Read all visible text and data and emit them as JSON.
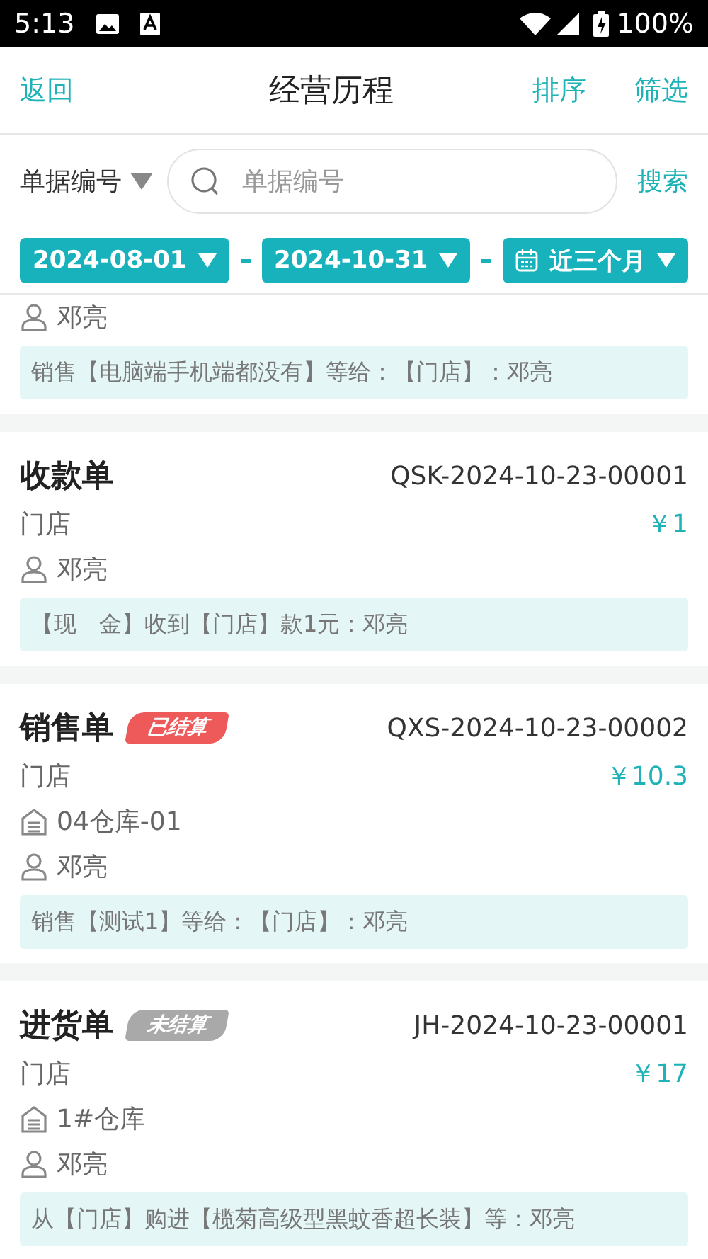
{
  "status_bar": {
    "time": "5:13",
    "battery": "100%"
  },
  "header": {
    "back": "返回",
    "title": "经营历程",
    "actions": [
      "排序",
      "筛选"
    ]
  },
  "search": {
    "field_type": "单据编号",
    "placeholder": "单据编号",
    "button": "搜索"
  },
  "date_filter": {
    "start": "2024-08-01",
    "end": "2024-10-31",
    "range": "近三个月"
  },
  "records": [
    {
      "person": "邓亮",
      "note": "销售【电脑端手机端都没有】等给：【门店】：邓亮"
    },
    {
      "title": "收款单",
      "number": "QSK-2024-10-23-00001",
      "shop": "门店",
      "amount": "￥1",
      "person": "邓亮",
      "note": "【现　金】收到【门店】款1元：邓亮"
    },
    {
      "title": "销售单",
      "badge": {
        "label": "已结算",
        "settled": true
      },
      "number": "QXS-2024-10-23-00002",
      "shop": "门店",
      "amount": "￥10.3",
      "warehouse": "04仓库-01",
      "person": "邓亮",
      "note": "销售【测试1】等给：【门店】：邓亮"
    },
    {
      "title": "进货单",
      "badge": {
        "label": "未结算",
        "settled": false
      },
      "number": "JH-2024-10-23-00001",
      "shop": "门店",
      "amount": "￥17",
      "warehouse": "1#仓库",
      "person": "邓亮",
      "note": "从【门店】购进【榄菊高级型黑蚊香超长装】等：邓亮"
    }
  ]
}
